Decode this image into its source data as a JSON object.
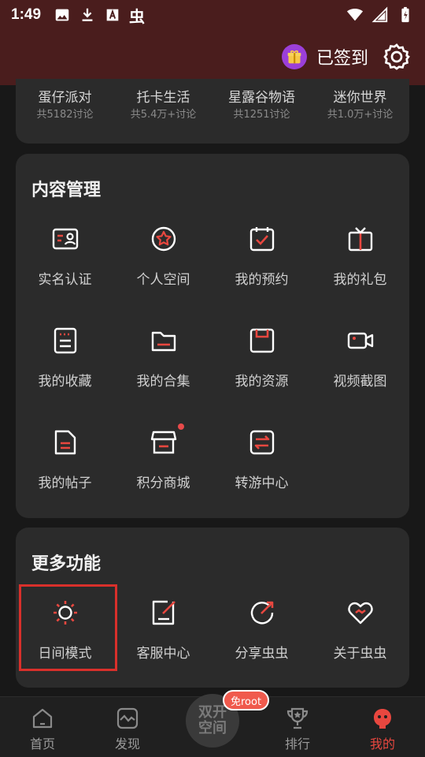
{
  "status_bar": {
    "time": "1:49",
    "app_glyph": "虫"
  },
  "header": {
    "signin_label": "已签到"
  },
  "games": [
    {
      "name": "蛋仔派对",
      "count": "共5182讨论"
    },
    {
      "name": "托卡生活",
      "count": "共5.4万+讨论"
    },
    {
      "name": "星露谷物语",
      "count": "共1251讨论"
    },
    {
      "name": "迷你世界",
      "count": "共1.0万+讨论"
    }
  ],
  "content_management": {
    "title": "内容管理",
    "items": [
      {
        "label": "实名认证",
        "icon": "id-card-icon"
      },
      {
        "label": "个人空间",
        "icon": "star-circle-icon"
      },
      {
        "label": "我的预约",
        "icon": "calendar-check-icon"
      },
      {
        "label": "我的礼包",
        "icon": "gift-box-icon"
      },
      {
        "label": "我的收藏",
        "icon": "bookmark-list-icon"
      },
      {
        "label": "我的合集",
        "icon": "folder-icon"
      },
      {
        "label": "我的资源",
        "icon": "save-disk-icon"
      },
      {
        "label": "视频截图",
        "icon": "video-camera-icon"
      },
      {
        "label": "我的帖子",
        "icon": "document-icon"
      },
      {
        "label": "积分商城",
        "icon": "store-icon"
      },
      {
        "label": "转游中心",
        "icon": "transfer-icon"
      }
    ]
  },
  "more_features": {
    "title": "更多功能",
    "items": [
      {
        "label": "日间模式",
        "icon": "sun-icon"
      },
      {
        "label": "客服中心",
        "icon": "edit-note-icon"
      },
      {
        "label": "分享虫虫",
        "icon": "share-arrow-icon"
      },
      {
        "label": "关于虫虫",
        "icon": "heart-icon"
      }
    ]
  },
  "bottom_nav": {
    "items": [
      {
        "label": "首页",
        "icon": "home-icon"
      },
      {
        "label": "发现",
        "icon": "discover-icon"
      },
      {
        "label": "排行",
        "icon": "trophy-icon"
      },
      {
        "label": "我的",
        "icon": "profile-bug-icon"
      }
    ],
    "center_line1": "双开",
    "center_line2": "空间",
    "root_badge": "免root"
  },
  "colors": {
    "accent": "#e8473f",
    "header_bg": "#4a1d1d",
    "card_bg": "#2b2b2b"
  }
}
